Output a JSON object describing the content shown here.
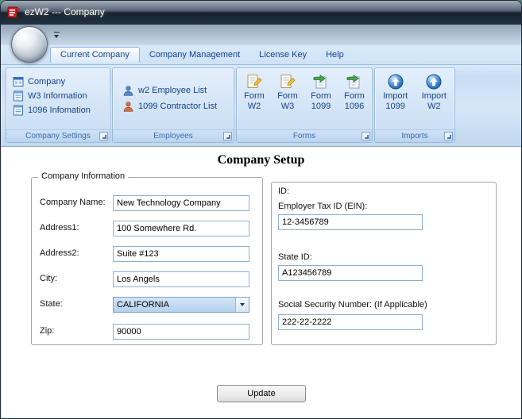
{
  "window": {
    "title": "ezW2 --- Company"
  },
  "ribbon": {
    "tabs": [
      {
        "label": "Current Company"
      },
      {
        "label": "Company Management"
      },
      {
        "label": "License Key"
      },
      {
        "label": "Help"
      }
    ],
    "groups": [
      {
        "label": "Company Settings",
        "items": [
          {
            "label": "Company"
          },
          {
            "label": "W3 Information"
          },
          {
            "label": "1096 Infomation"
          }
        ]
      },
      {
        "label": "Employees",
        "items": [
          {
            "label": "w2 Employee List"
          },
          {
            "label": "1099 Contractor List"
          }
        ]
      },
      {
        "label": "Forms",
        "items": [
          {
            "top": "Form",
            "bottom": "W2"
          },
          {
            "top": "Form",
            "bottom": "W3"
          },
          {
            "top": "Form",
            "bottom": "1099"
          },
          {
            "top": "Form",
            "bottom": "1096"
          }
        ]
      },
      {
        "label": "Imports",
        "items": [
          {
            "top": "Import",
            "bottom": "1099"
          },
          {
            "top": "Import",
            "bottom": "W2"
          }
        ]
      }
    ]
  },
  "main": {
    "title": "Company Setup",
    "company_info": {
      "legend": "Company Information",
      "fields": [
        {
          "label": "Company Name:",
          "value": "New Technology Company"
        },
        {
          "label": "Address1:",
          "value": "100 Somewhere Rd."
        },
        {
          "label": "Address2:",
          "value": "Suite #123"
        },
        {
          "label": "City:",
          "value": "Los Angels"
        },
        {
          "label": "State:",
          "value": "CALIFORNIA"
        },
        {
          "label": "Zip:",
          "value": "90000"
        }
      ]
    },
    "id_section": {
      "heading": "ID:",
      "fields": [
        {
          "label": "Employer Tax ID (EIN):",
          "value": "12-3456789"
        },
        {
          "label": "State ID:",
          "value": "A123456789"
        },
        {
          "label": "Social Security Number: (If Applicable)",
          "value": "222-22-2222"
        }
      ]
    },
    "update_button": "Update"
  }
}
